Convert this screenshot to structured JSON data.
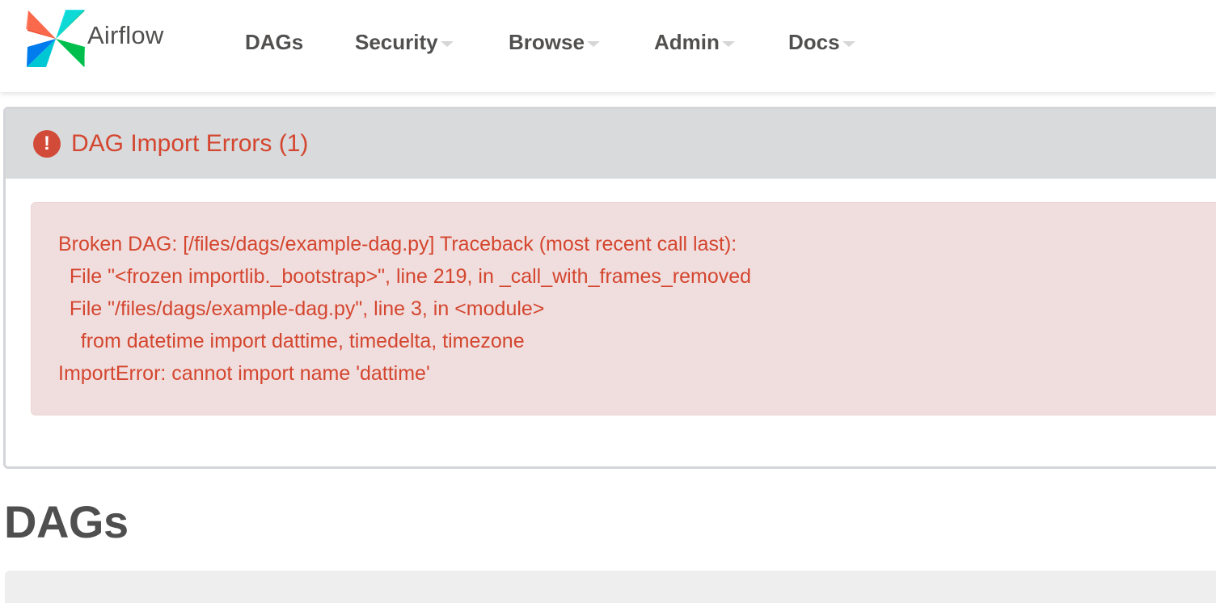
{
  "brand": {
    "name": "Airflow",
    "logo_icon": "airflow-pinwheel-icon"
  },
  "nav": {
    "items": [
      {
        "label": "DAGs",
        "dropdown": false
      },
      {
        "label": "Security",
        "dropdown": true
      },
      {
        "label": "Browse",
        "dropdown": true
      },
      {
        "label": "Admin",
        "dropdown": true
      },
      {
        "label": "Docs",
        "dropdown": true
      }
    ]
  },
  "import_errors": {
    "icon": "exclamation-circle-icon",
    "title": "DAG Import Errors (1)",
    "traceback": "Broken DAG: [/files/dags/example-dag.py] Traceback (most recent call last):\n  File \"<frozen importlib._bootstrap>\", line 219, in _call_with_frames_removed\n  File \"/files/dags/example-dag.py\", line 3, in <module>\n    from datetime import dattime, timedelta, timezone\nImportError: cannot import name 'dattime'"
  },
  "page": {
    "title": "DAGs"
  },
  "colors": {
    "error_text": "#d4462f",
    "error_bg": "#f0dede",
    "panel_header_bg": "#d8dadc",
    "nav_text": "#51504f"
  }
}
